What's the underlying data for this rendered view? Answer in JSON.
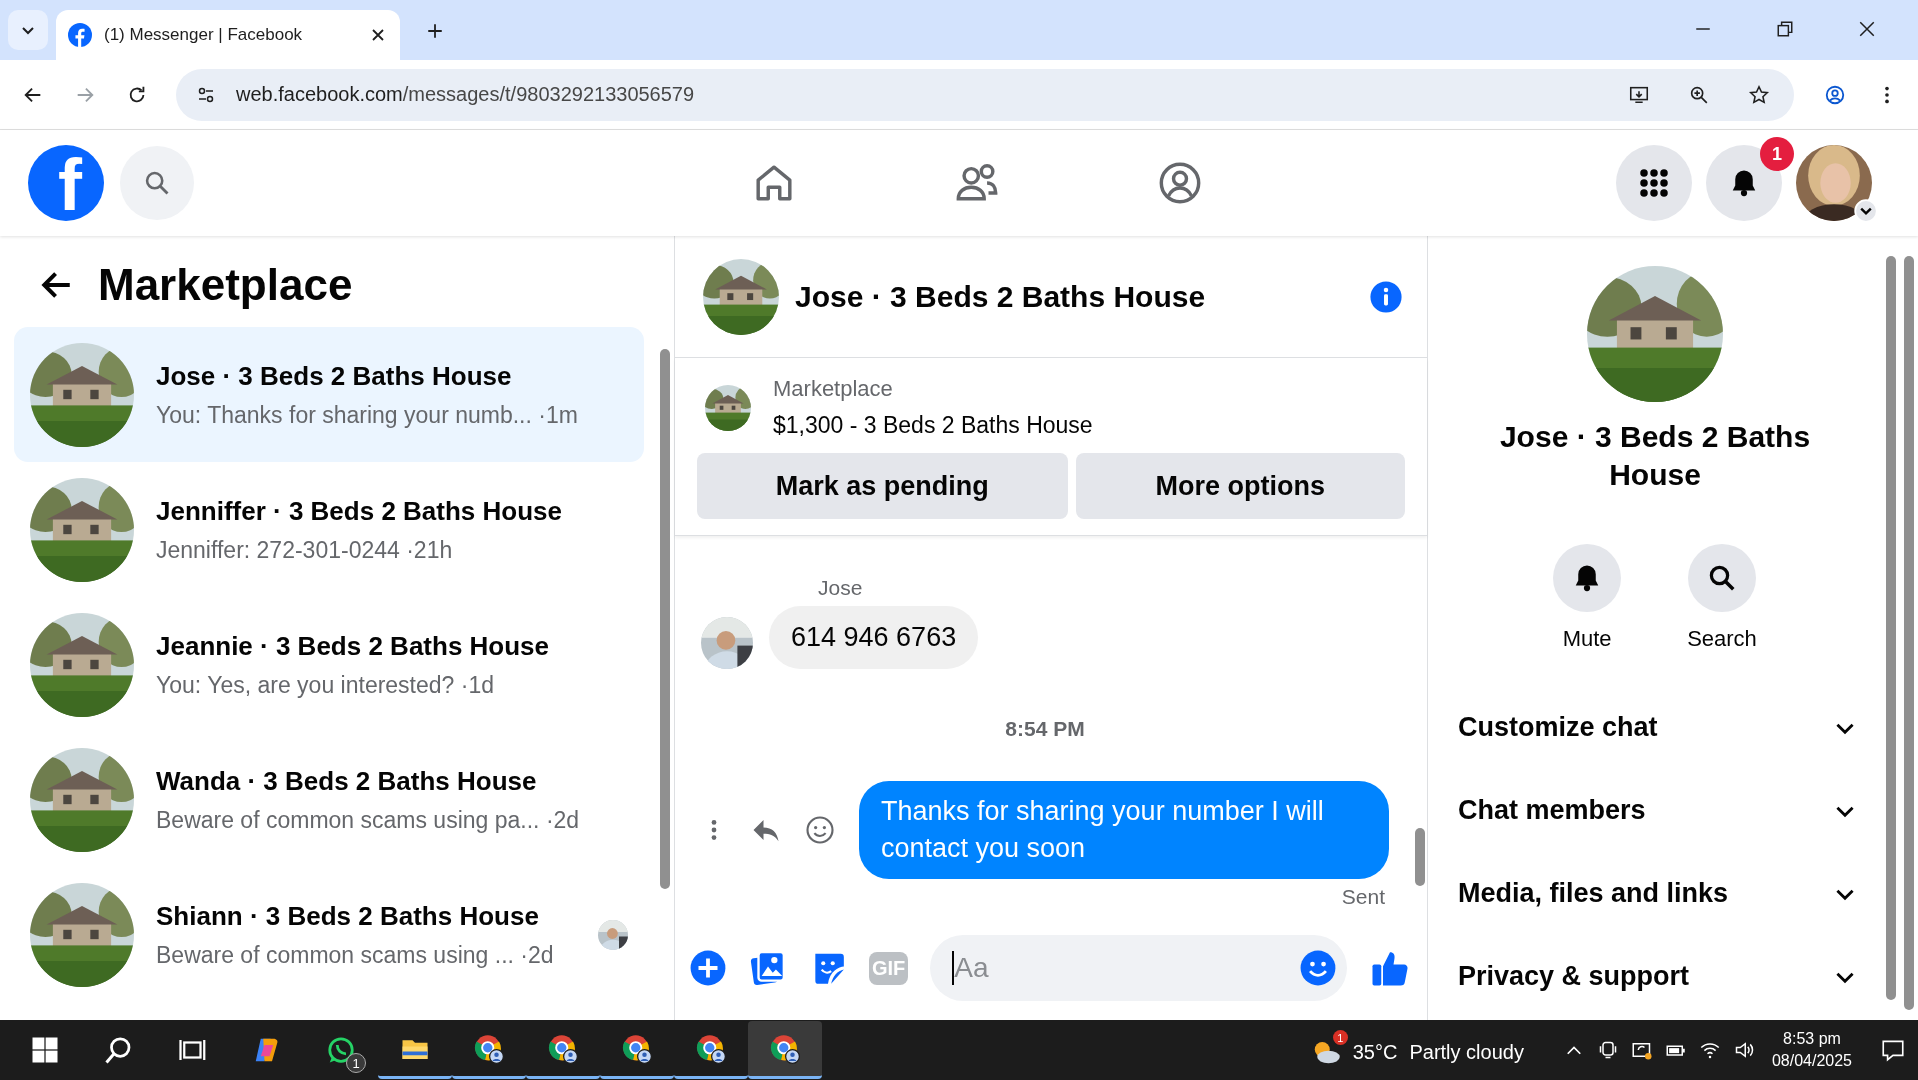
{
  "browser": {
    "tab_title": "(1) Messenger | Facebook",
    "url_host": "web.facebook.com",
    "url_path": "/messages/t/9803292133056579"
  },
  "header": {
    "logo": "f",
    "notifications_badge": "1"
  },
  "sidebar": {
    "title": "Marketplace",
    "conversations": [
      {
        "name": "Jose · 3 Beds 2 Baths House",
        "preview": "You: Thanks for sharing your numb...",
        "time": "·1m",
        "selected": true,
        "seen": false
      },
      {
        "name": "Jenniffer · 3 Beds 2 Baths House",
        "preview": "Jenniffer: 272-301-0244",
        "time": "·21h",
        "selected": false,
        "seen": false
      },
      {
        "name": "Jeannie · 3 Beds 2 Baths House",
        "preview": "You: Yes, are you interested?",
        "time": "·1d",
        "selected": false,
        "seen": false
      },
      {
        "name": "Wanda · 3 Beds 2 Baths House",
        "preview": "Beware of common scams using pa...",
        "time": "·2d",
        "selected": false,
        "seen": false
      },
      {
        "name": "Shiann · 3 Beds 2 Baths House",
        "preview": "Beware of common scams using ...",
        "time": "·2d",
        "selected": false,
        "seen": true
      }
    ]
  },
  "chat": {
    "title": "Jose · 3 Beds 2 Baths House",
    "listing": {
      "label": "Marketplace",
      "price": "$1,300 - 3 Beds 2 Baths House",
      "buttons": [
        "Mark as pending",
        "More options"
      ]
    },
    "messages": [
      {
        "kind": "incoming",
        "sender": "Jose",
        "text": "614 946 6763"
      },
      {
        "kind": "timestamp",
        "text": "8:54 PM"
      },
      {
        "kind": "outgoing",
        "text": "Thanks for sharing your number I will contact you soon",
        "status": "Sent"
      }
    ],
    "composer": {
      "placeholder": "Aa",
      "gif": "GIF"
    }
  },
  "details": {
    "name": "Jose · 3 Beds 2 Baths House",
    "actions": [
      {
        "kind": "mute",
        "label": "Mute"
      },
      {
        "kind": "search",
        "label": "Search"
      }
    ],
    "sections": [
      {
        "label": "Customize chat",
        "expanded": false
      },
      {
        "label": "Chat members",
        "expanded": false
      },
      {
        "label": "Media, files and links",
        "expanded": false
      },
      {
        "label": "Privacy & support",
        "expanded": false
      }
    ]
  },
  "taskbar": {
    "apps": [
      {
        "kind": "start",
        "running": false,
        "selected": false
      },
      {
        "kind": "search",
        "running": false,
        "selected": false
      },
      {
        "kind": "taskview",
        "running": false,
        "selected": false
      },
      {
        "kind": "copilot",
        "running": false,
        "selected": false
      },
      {
        "kind": "whatsapp",
        "running": false,
        "selected": false,
        "badge": "1"
      },
      {
        "kind": "files",
        "running": true,
        "selected": false
      },
      {
        "kind": "chrome",
        "running": true,
        "selected": false
      },
      {
        "kind": "chrome",
        "running": true,
        "selected": false
      },
      {
        "kind": "chrome",
        "running": true,
        "selected": false
      },
      {
        "kind": "chrome",
        "running": true,
        "selected": false
      },
      {
        "kind": "chrome",
        "running": true,
        "selected": true
      }
    ],
    "weather": {
      "badge": "1",
      "temp": "35°C",
      "condition": "Partly cloudy"
    },
    "time": "8:53 pm",
    "date": "08/04/2025"
  }
}
